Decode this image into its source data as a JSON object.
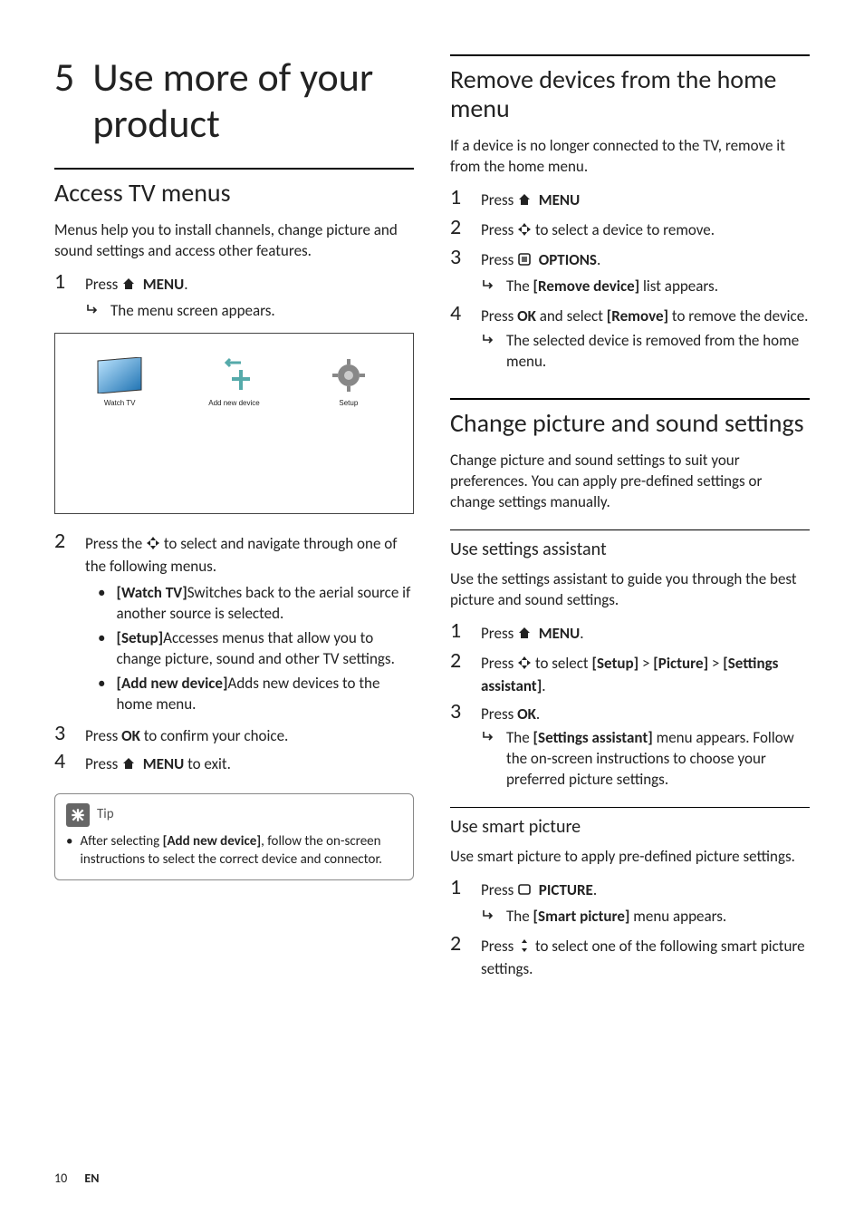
{
  "chapter": {
    "number": "5",
    "title": "Use more of your product"
  },
  "left": {
    "section1": {
      "heading": "Access TV menus",
      "intro": "Menus help you to install channels, change picture and sound settings and access other features.",
      "steps": {
        "s1a": "Press ",
        "s1b": "MENU",
        "s1c": ".",
        "s1_sub": "The menu screen appears.",
        "s2a": "Press the ",
        "s2b": " to select and navigate through one of the following menus.",
        "s2_b1a": "[Watch TV]",
        "s2_b1b": "Switches back to the aerial source if another source is selected.",
        "s2_b2a": "[Setup]",
        "s2_b2b": "Accesses menus that allow you to change picture, sound and other TV settings.",
        "s2_b3a": "[Add new device]",
        "s2_b3b": "Adds new devices to the home menu.",
        "s3a": "Press ",
        "s3b": "OK",
        "s3c": " to confirm your choice.",
        "s4a": "Press ",
        "s4b": "MENU",
        "s4c": " to exit."
      },
      "fig": {
        "watch": "Watch TV",
        "add": "Add new device",
        "setup": "Setup"
      },
      "tip": {
        "label": "Tip",
        "text1": "After selecting ",
        "text2": "[Add new device]",
        "text3": ", follow the on-screen instructions to select the correct device and connector."
      }
    }
  },
  "right": {
    "section1": {
      "heading": "Remove devices from the home menu",
      "intro": "If a device is no longer connected to the TV, remove it from the home menu.",
      "s1a": "Press ",
      "s1b": "MENU",
      "s2a": "Press ",
      "s2b": " to select a device to remove.",
      "s3a": "Press ",
      "s3b": "OPTIONS",
      "s3c": ".",
      "s3_sub_a": "The ",
      "s3_sub_b": "[Remove device]",
      "s3_sub_c": " list appears.",
      "s4a": "Press ",
      "s4b": "OK",
      "s4c": " and select ",
      "s4d": "[Remove]",
      "s4e": " to remove the device.",
      "s4_sub": "The selected device is removed from the home menu."
    },
    "section2": {
      "heading": "Change picture and sound settings",
      "intro": "Change picture and sound settings to suit your preferences. You can apply pre-defined settings or change settings manually.",
      "sub1": {
        "heading": "Use settings assistant",
        "intro": "Use the settings assistant to guide you through the best picture and sound settings.",
        "s1a": "Press ",
        "s1b": "MENU",
        "s1c": ".",
        "s2a": "Press ",
        "s2b": " to select ",
        "s2c": "[Setup]",
        "s2d": " > ",
        "s2e": "[Picture]",
        "s2f": " > ",
        "s2g": "[Settings assistant]",
        "s2h": ".",
        "s3a": "Press ",
        "s3b": "OK",
        "s3c": ".",
        "s3_sub_a": "The ",
        "s3_sub_b": "[Settings assistant]",
        "s3_sub_c": " menu appears. Follow the on-screen instructions to choose your preferred picture settings."
      },
      "sub2": {
        "heading": "Use smart picture",
        "intro": "Use smart picture to apply pre-defined picture settings.",
        "s1a": "Press ",
        "s1b": "PICTURE",
        "s1c": ".",
        "s1_sub_a": "The ",
        "s1_sub_b": "[Smart picture]",
        "s1_sub_c": " menu appears.",
        "s2a": "Press ",
        "s2b": " to select one of the following smart picture settings."
      }
    }
  },
  "footer": {
    "page": "10",
    "lang": "EN"
  }
}
